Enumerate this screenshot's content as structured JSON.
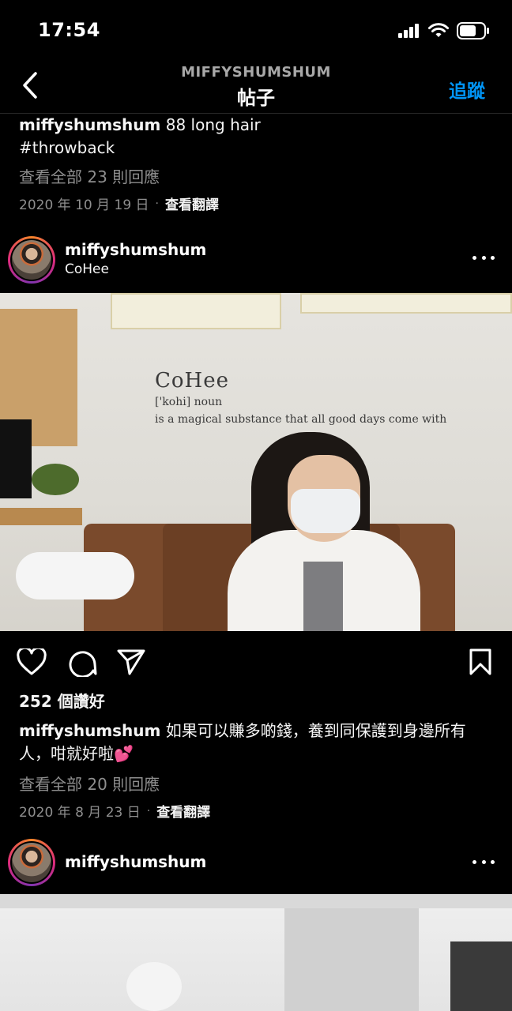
{
  "status": {
    "time": "17:54"
  },
  "nav": {
    "subtitle": "MIFFYSHUMSHUM",
    "title": "帖子",
    "follow_label": "追蹤"
  },
  "prev_post": {
    "username": "miffyshumshum",
    "caption_text": "88 long hair",
    "caption_line2": "#throwback",
    "view_comments": "查看全部 23 則回應",
    "date": "2020 年 10 月 19 日",
    "separator": "·",
    "translate": "查看翻譯"
  },
  "post1": {
    "username": "miffyshumshum",
    "location": "CoHee",
    "photo": {
      "wall_title": "CoHee",
      "wall_phonetic": "['kohi] noun",
      "wall_line": "is a magical substance that all good days come with"
    },
    "likes": "252 個讚好",
    "caption_username": "miffyshumshum",
    "caption_text": "如果可以賺多啲錢，養到同保護到身邊所有人，咁就好啦💕",
    "view_comments": "查看全部 20 則回應",
    "date": "2020 年 8 月 23 日",
    "separator": "·",
    "translate": "查看翻譯"
  },
  "post2": {
    "username": "miffyshumshum"
  },
  "icons": {
    "back": "chevron-left-icon",
    "more": "more-horizontal-icon",
    "like": "heart-icon",
    "comment": "comment-icon",
    "share": "send-icon",
    "save": "bookmark-icon"
  },
  "colors": {
    "accent": "#0095f6",
    "background": "#000000",
    "muted": "#8e8e8e"
  }
}
